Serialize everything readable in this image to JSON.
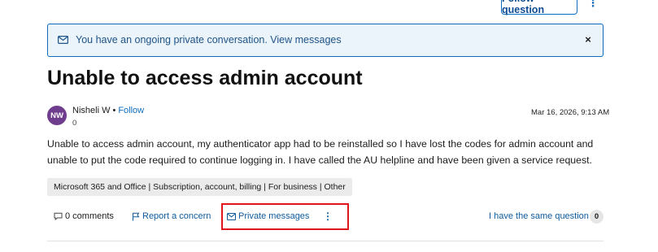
{
  "header": {
    "follow_question_label": "Follow question",
    "more_label": "⋮"
  },
  "banner": {
    "message": "You have an ongoing private conversation. View messages",
    "close_label": "×"
  },
  "question": {
    "title": "Unable to access admin account",
    "author": {
      "initials": "NW",
      "name": "Nisheli W",
      "separator": "•",
      "follow_label": "Follow",
      "reputation": "0"
    },
    "date": "Mar 16, 2026, 9:13 AM",
    "body_lines": [
      "Unable to access admin account, my authenticator app had to be reinstalled so I have lost the codes for admin account and",
      "unable to put the code required to continue logging in. I have called the AU helpline and have been given a service request."
    ],
    "tag": "Microsoft 365 and Office | Subscription, account, billing | For business | Other"
  },
  "actions": {
    "comments_label": "0 comments",
    "report_label": "Report a concern",
    "private_messages_label": "Private messages",
    "more_label": "⋮",
    "same_question_label": "I have the same question",
    "same_question_count": "0"
  },
  "colors": {
    "accent": "#0f6cbd",
    "banner_bg": "#eaf4fa",
    "avatar_bg": "#6f3d8d",
    "highlight": "#e0161b"
  }
}
